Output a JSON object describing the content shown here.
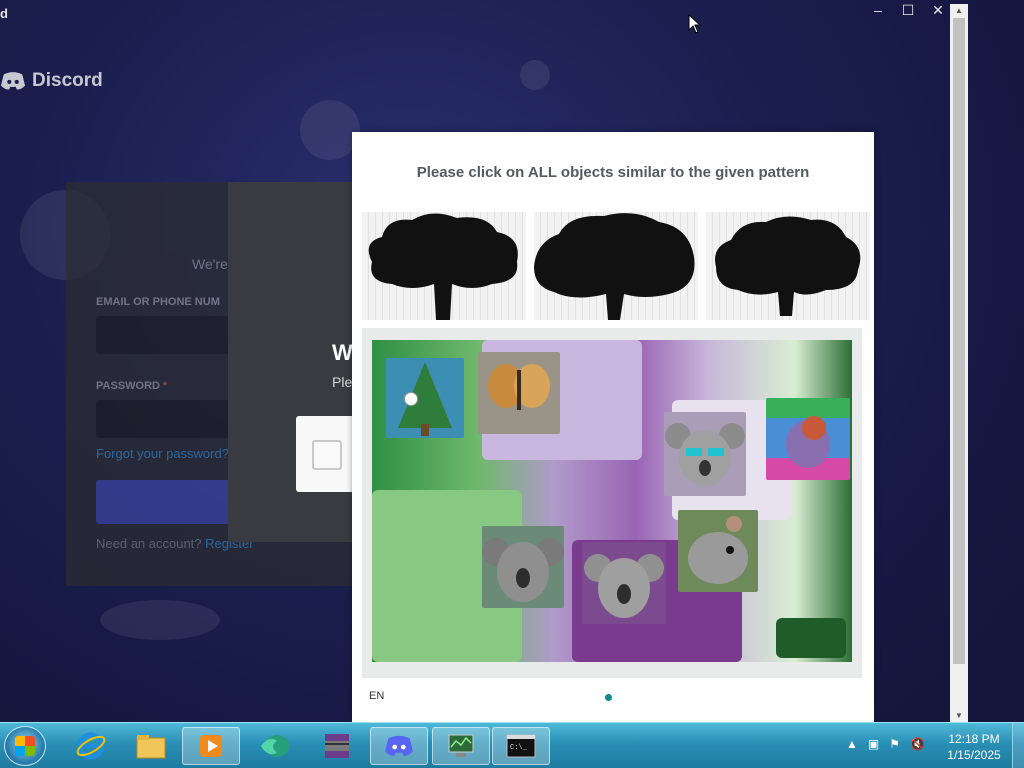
{
  "app": {
    "corner_letter": "d",
    "brand": "Discord"
  },
  "window_controls": {
    "minimize": "–",
    "maximize": "☐",
    "close": "✕"
  },
  "login": {
    "subtitle": "We're",
    "email_label": "EMAIL OR PHONE NUM",
    "password_label": "PASSWORD",
    "required_mark": "*",
    "forgot": "Forgot your password?",
    "need_account": "Need an account?",
    "register": "Register"
  },
  "verify": {
    "title": "W",
    "text": "Ple"
  },
  "captcha": {
    "prompt": "Please click on ALL objects similar to the given pattern",
    "language": "EN",
    "tiles": [
      {
        "name": "fir-tree"
      },
      {
        "name": "butterfly"
      },
      {
        "name": "koala-sunglasses"
      },
      {
        "name": "squirrel-rainbow"
      },
      {
        "name": "koala"
      },
      {
        "name": "koala-purple"
      },
      {
        "name": "squirrel"
      }
    ]
  },
  "taskbar": {
    "items": [
      "start",
      "internet-explorer",
      "file-explorer",
      "media-player",
      "app-green",
      "winrar",
      "discord",
      "system-monitor",
      "command-prompt"
    ],
    "clock_time": "12:18 PM",
    "clock_date": "1/15/2025"
  }
}
